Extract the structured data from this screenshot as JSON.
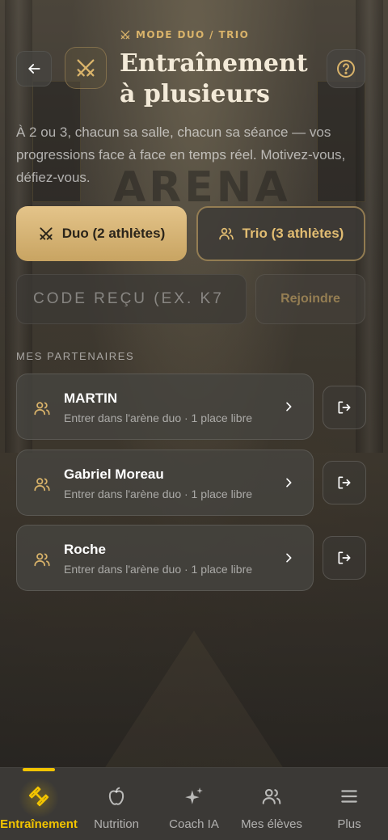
{
  "header": {
    "eyebrow": "MODE DUO / TRIO",
    "title": "Entraînement\nà plusieurs",
    "description": "À 2 ou 3, chacun sa salle, chacun sa séance — vos progressions face à face en temps réel. Motivez-vous, défiez-vous."
  },
  "modes": {
    "duo_label": "Duo (2 athlètes)",
    "trio_label": "Trio (3 athlètes)",
    "selected": "duo"
  },
  "join": {
    "placeholder": "CODE REÇU (EX. K7",
    "button_label": "Rejoindre"
  },
  "partners": {
    "section_label": "MES PARTENAIRES",
    "items": [
      {
        "name": "MARTIN",
        "subtitle": "Entrer dans l'arène duo · 1 place libre"
      },
      {
        "name": "Gabriel Moreau",
        "subtitle": "Entrer dans l'arène duo · 1 place libre"
      },
      {
        "name": "Roche",
        "subtitle": "Entrer dans l'arène duo · 1 place libre"
      }
    ]
  },
  "nav": {
    "items": [
      {
        "label": "Entraînement",
        "icon": "dumbbell-icon",
        "active": true
      },
      {
        "label": "Nutrition",
        "icon": "apple-icon",
        "active": false
      },
      {
        "label": "Coach IA",
        "icon": "sparkles-icon",
        "active": false
      },
      {
        "label": "Mes élèves",
        "icon": "users-icon",
        "active": false
      },
      {
        "label": "Plus",
        "icon": "menu-icon",
        "active": false
      }
    ]
  },
  "background": {
    "watermark_text": "ARENA"
  },
  "colors": {
    "accent_gold": "#d9b36a",
    "nav_active": "#f2c400",
    "card_bg": "#464440"
  }
}
